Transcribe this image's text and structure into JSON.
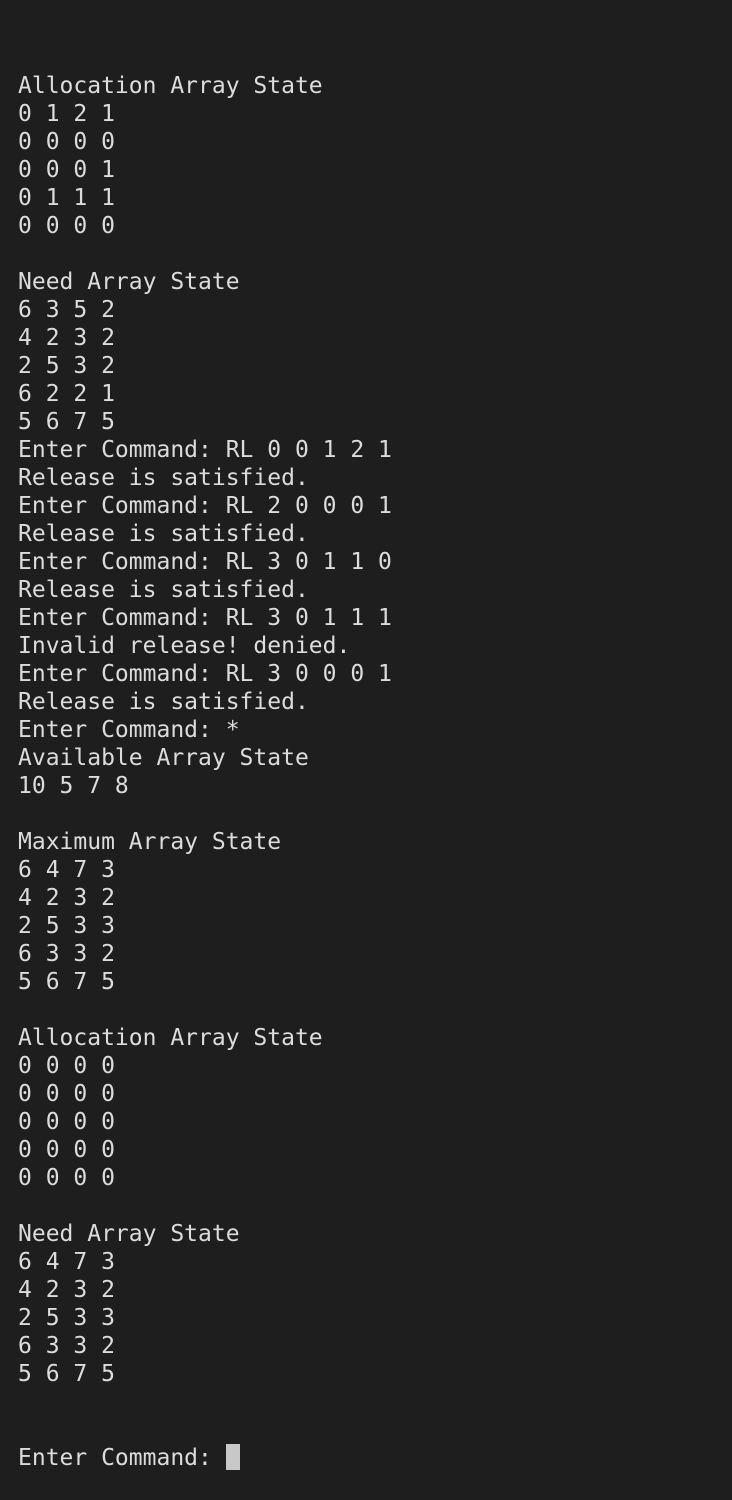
{
  "terminal": {
    "lines": [
      "Allocation Array State",
      "0 1 2 1",
      "0 0 0 0",
      "0 0 0 1",
      "0 1 1 1",
      "0 0 0 0",
      "",
      "Need Array State",
      "6 3 5 2",
      "4 2 3 2",
      "2 5 3 2",
      "6 2 2 1",
      "5 6 7 5",
      "Enter Command: RL 0 0 1 2 1",
      "Release is satisfied.",
      "Enter Command: RL 2 0 0 0 1",
      "Release is satisfied.",
      "Enter Command: RL 3 0 1 1 0",
      "Release is satisfied.",
      "Enter Command: RL 3 0 1 1 1",
      "Invalid release! denied.",
      "Enter Command: RL 3 0 0 0 1",
      "Release is satisfied.",
      "Enter Command: *",
      "Available Array State",
      "10 5 7 8",
      "",
      "Maximum Array State",
      "6 4 7 3",
      "4 2 3 2",
      "2 5 3 3",
      "6 3 3 2",
      "5 6 7 5",
      "",
      "Allocation Array State",
      "0 0 0 0",
      "0 0 0 0",
      "0 0 0 0",
      "0 0 0 0",
      "0 0 0 0",
      "",
      "Need Array State",
      "6 4 7 3",
      "4 2 3 2",
      "2 5 3 3",
      "6 3 3 2",
      "5 6 7 5"
    ],
    "prompt": "Enter Command: ",
    "input_value": ""
  },
  "colors": {
    "background": "#1e1e1e",
    "foreground": "#dcdcdc",
    "cursor": "#c8c8c8"
  }
}
